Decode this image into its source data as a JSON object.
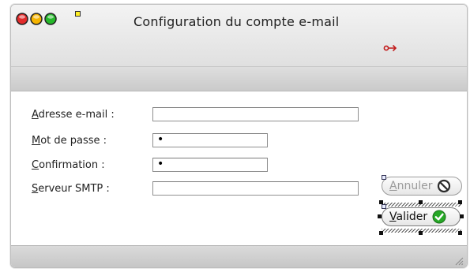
{
  "window": {
    "title": "Configuration du compte e-mail"
  },
  "form": {
    "email": {
      "label_first": "A",
      "label_rest": "dresse e-mail :",
      "value": ""
    },
    "password": {
      "label_first": "M",
      "label_rest": "ot de passe :",
      "value": "•"
    },
    "confirm": {
      "label_first": "C",
      "label_rest": "onfirmation :",
      "value": "•"
    },
    "smtp": {
      "label_first": "S",
      "label_rest": "erveur SMTP :",
      "value": ""
    }
  },
  "buttons": {
    "cancel": {
      "first": "A",
      "rest": "nnuler",
      "icon": "no-entry-icon"
    },
    "ok": {
      "first": "V",
      "rest": "alider",
      "icon": "check-circle-icon"
    }
  },
  "colors": {
    "close": "#e22b2b",
    "minimize": "#f5b400",
    "maximize": "#25b82a",
    "ok_green": "#26a826",
    "exit_red": "#c21a1a"
  }
}
